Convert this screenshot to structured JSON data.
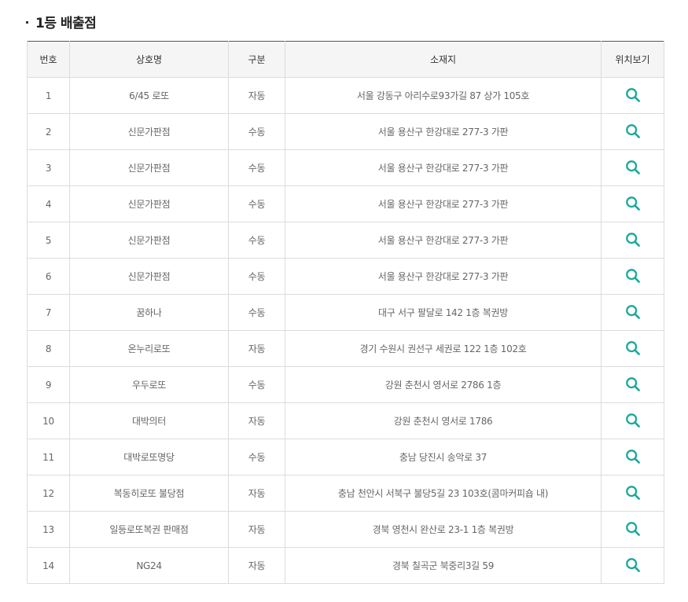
{
  "section": {
    "title": "1등 배출점"
  },
  "table": {
    "headers": [
      "번호",
      "상호명",
      "구분",
      "소재지",
      "위치보기"
    ],
    "rows": [
      {
        "no": "1",
        "name": "6/45 로또",
        "type": "자동",
        "address": "서울 강동구 아리수로93가길 87 상가 105호"
      },
      {
        "no": "2",
        "name": "신문가판점",
        "type": "수동",
        "address": "서울 용산구 한강대로 277-3 가판"
      },
      {
        "no": "3",
        "name": "신문가판점",
        "type": "수동",
        "address": "서울 용산구 한강대로 277-3 가판"
      },
      {
        "no": "4",
        "name": "신문가판점",
        "type": "수동",
        "address": "서울 용산구 한강대로 277-3 가판"
      },
      {
        "no": "5",
        "name": "신문가판점",
        "type": "수동",
        "address": "서울 용산구 한강대로 277-3 가판"
      },
      {
        "no": "6",
        "name": "신문가판점",
        "type": "수동",
        "address": "서울 용산구 한강대로 277-3 가판"
      },
      {
        "no": "7",
        "name": "꿈하나",
        "type": "수동",
        "address": "대구 서구 팔달로 142 1층 복권방"
      },
      {
        "no": "8",
        "name": "온누리로또",
        "type": "자동",
        "address": "경기 수원시 권선구 세권로 122 1층 102호"
      },
      {
        "no": "9",
        "name": "우두로또",
        "type": "수동",
        "address": "강원 춘천시 영서로 2786 1층"
      },
      {
        "no": "10",
        "name": "대박의터",
        "type": "자동",
        "address": "강원 춘천시 영서로 1786"
      },
      {
        "no": "11",
        "name": "대박로또명당",
        "type": "수동",
        "address": "충남 당진시 송악로 37"
      },
      {
        "no": "12",
        "name": "복동히로또 불당점",
        "type": "자동",
        "address": "충남 천안시 서북구 불당5길 23 103호(콤마커피숍 내)"
      },
      {
        "no": "13",
        "name": "일등로또복권 판매점",
        "type": "자동",
        "address": "경북 영천시 완산로 23-1 1층 복권방"
      },
      {
        "no": "14",
        "name": "NG24",
        "type": "자동",
        "address": "경북 칠곡군 북중리3길 59"
      }
    ],
    "location_icon": "search-icon"
  },
  "colors": {
    "accent": "#1aa89c",
    "header_bg": "#f5f5f5",
    "border": "#dcdcdc",
    "top_border": "#555555"
  }
}
